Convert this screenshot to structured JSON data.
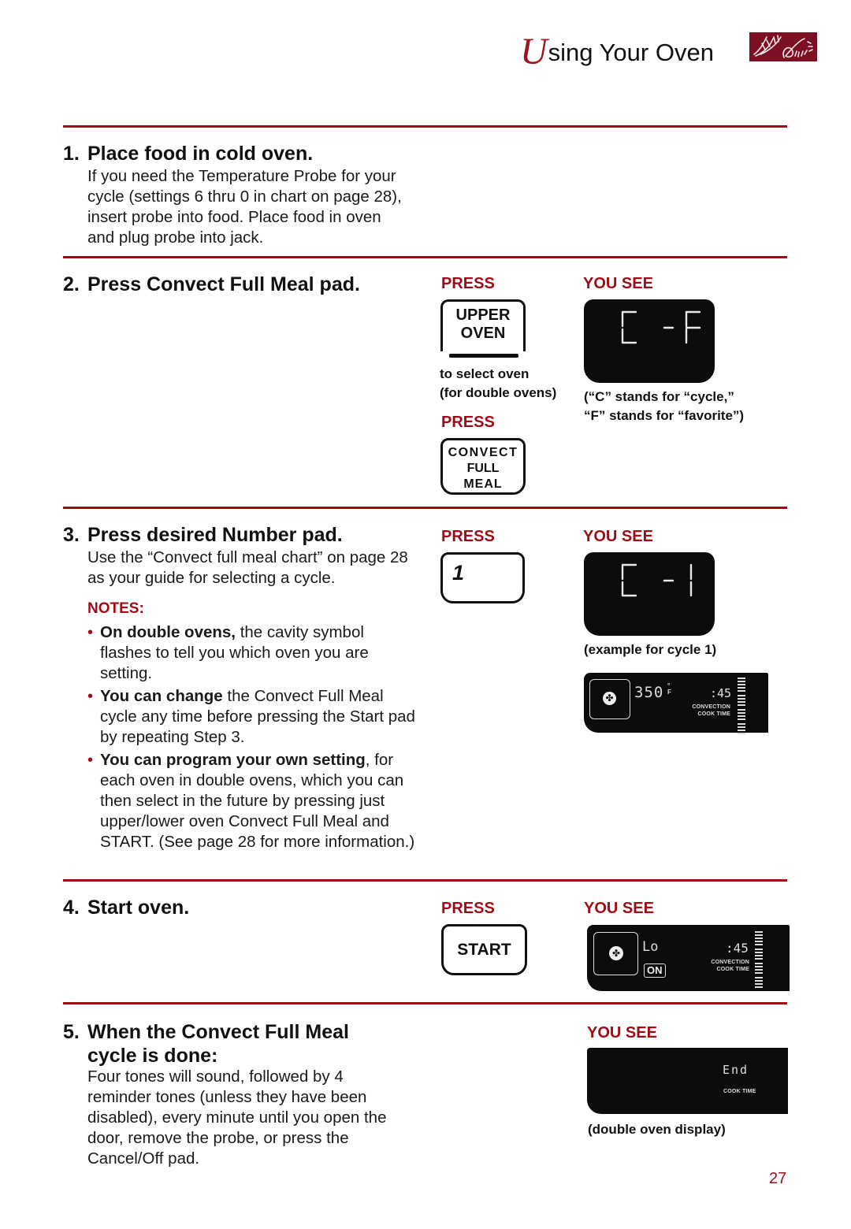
{
  "header": {
    "title_initial": "U",
    "title_rest": "sing Your Oven",
    "logo_icon": "decorative-artwork-icon"
  },
  "labels": {
    "press": "PRESS",
    "you_see": "YOU SEE"
  },
  "step1": {
    "number": "1.",
    "title": "Place food in cold oven.",
    "body": "If you need the Temperature Probe for your cycle (settings 6 thru 0 in chart on page 28), insert probe into food. Place food in oven and plug probe into jack."
  },
  "step2": {
    "number": "2.",
    "title": "Press Convect Full Meal pad.",
    "pad_upper_oven": [
      "UPPER",
      "OVEN"
    ],
    "upper_oven_caption": [
      "to select oven",
      "(for double ovens)"
    ],
    "pad_convect": [
      "CONVECT",
      "FULL",
      "MEAL"
    ],
    "display_text": "C -F",
    "display_caption": [
      "(“C” stands for “cycle,”",
      "“F” stands for “favorite”)"
    ]
  },
  "step3": {
    "number": "3.",
    "title": "Press desired Number pad.",
    "body": "Use the “Convect full meal chart” on page 28 as your guide for selecting a cycle.",
    "pad_number": "1",
    "display_text": "C -1",
    "display_caption": "(example for cycle 1)",
    "wide_display": {
      "temperature": "350",
      "unit_deg": "°",
      "unit": "F",
      "time": ":45",
      "mode_label": "CONVECTION",
      "time_label": "COOK TIME",
      "icon": "convection-fan-icon"
    },
    "notes_title": "NOTES:",
    "notes": [
      {
        "bold": "On double ovens,",
        "text": " the cavity symbol flashes to tell you which oven you are setting."
      },
      {
        "bold": "You can change",
        "text": " the Convect Full Meal cycle any time before pressing the Start pad by repeating Step 3."
      },
      {
        "bold": "You can program your own setting",
        "text": ", for each oven in double ovens, which you can then select in the future by pressing just upper/lower oven Convect Full Meal and START. (See page 28 for more information.)"
      }
    ]
  },
  "step4": {
    "number": "4.",
    "title": "Start oven.",
    "pad_start": "START",
    "wide_display": {
      "temperature": "Lo",
      "on_badge": "ON",
      "time": ":45",
      "mode_label": "CONVECTION",
      "time_label": "COOK TIME",
      "icon": "convection-fan-icon"
    }
  },
  "step5": {
    "number": "5.",
    "title_line1": "When the Convect Full Meal",
    "title_line2": "cycle is done:",
    "body": "Four tones will sound, followed by 4 reminder tones (unless they have been disabled), every minute until you open the door, remove the probe, or press the Cancel/Off pad.",
    "display": {
      "text": "End",
      "time_label": "COOK TIME"
    },
    "display_caption": "(double oven display)"
  },
  "footer": {
    "page_number": "27"
  },
  "colors": {
    "accent_red": "#a00c16",
    "logo_maroon": "#7d0f22",
    "lcd_black": "#0b0d0c"
  }
}
